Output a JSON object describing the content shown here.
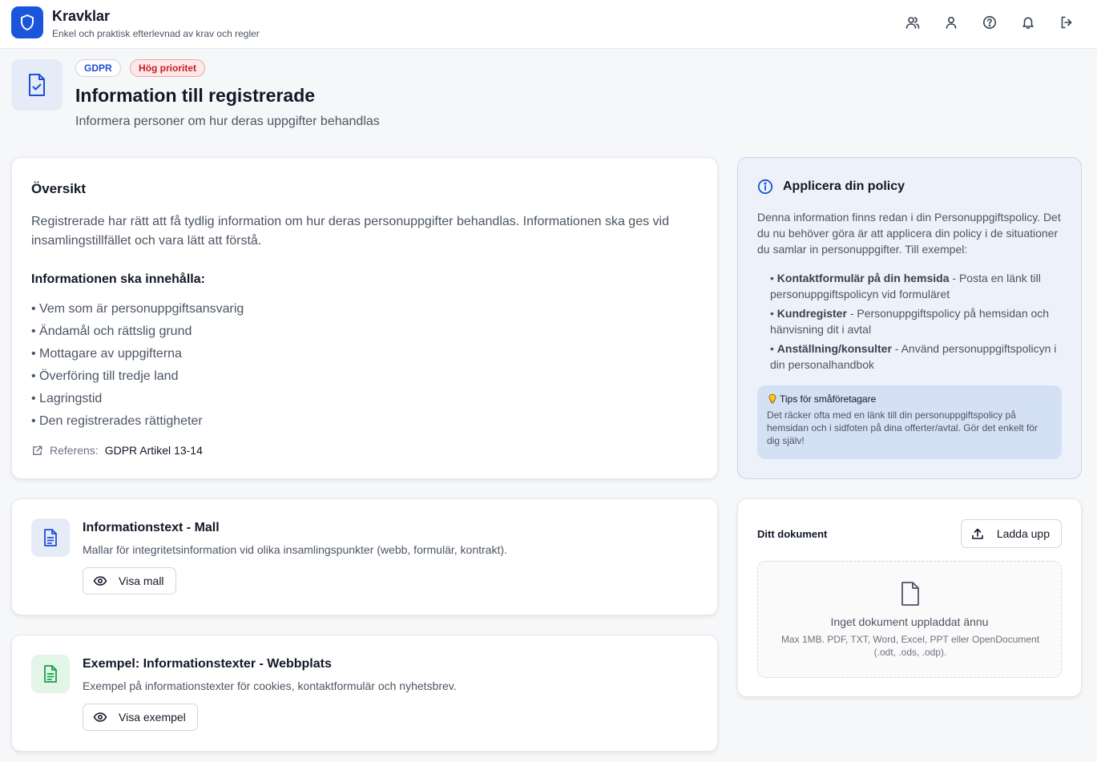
{
  "header": {
    "app_title": "Kravklar",
    "app_subtitle": "Enkel och praktisk efterlevnad av krav och regler",
    "icons": [
      "users-icon",
      "user-icon",
      "help-icon",
      "bell-icon",
      "logout-icon"
    ]
  },
  "page": {
    "badges": {
      "framework": "GDPR",
      "priority": "Hög prioritet"
    },
    "title": "Information till registrerade",
    "subtitle": "Informera personer om hur deras uppgifter behandlas"
  },
  "overview": {
    "title": "Översikt",
    "description": "Registrerade har rätt att få tydlig information om hur deras personuppgifter behandlas. Informationen ska ges vid insamlingstillfället och vara lätt att förstå.",
    "subheading": "Informationen ska innehålla:",
    "items": [
      "• Vem som är personuppgiftsansvarig",
      "• Ändamål och rättslig grund",
      "• Mottagare av uppgifterna",
      "• Överföring till tredje land",
      "• Lagringstid",
      "• Den registrerades rättigheter"
    ],
    "reference_label": "Referens:",
    "reference_value": "GDPR Artikel 13-14"
  },
  "resources": [
    {
      "title": "Informationstext - Mall",
      "description": "Mallar för integritetsinformation vid olika insamlingspunkter (webb, formulär, kontrakt).",
      "button": "Visa mall",
      "accent": "#1d4ed8"
    },
    {
      "title": "Exempel: Informationstexter - Webbplats",
      "description": "Exempel på informationstexter för cookies, kontaktformulär och nyhetsbrev.",
      "button": "Visa exempel",
      "accent": "#16a34a"
    }
  ],
  "policy": {
    "title": "Applicera din policy",
    "description": "Denna information finns redan i din Personuppgiftspolicy. Det du nu behöver göra är att applicera din policy i de situationer du samlar in personuppgifter. Till exempel:",
    "items": [
      {
        "bold": "Kontaktformulär på din hemsida",
        "text": " - Posta en länk till personuppgiftspolicyn vid formuläret"
      },
      {
        "bold": "Kundregister",
        "text": " - Personuppgiftspolicy på hemsidan och hänvisning dit i avtal"
      },
      {
        "bold": "Anställning/konsulter",
        "text": " - Använd personuppgiftspolicyn i din personalhandbok"
      }
    ],
    "tip_title": "Tips för småföretagare",
    "tip_text": "Det räcker ofta med en länk till din personuppgiftspolicy på hemsidan och i sidfoten på dina offerter/avtal. Gör det enkelt för dig själv!"
  },
  "document": {
    "title": "Ditt dokument",
    "upload_button": "Ladda upp",
    "empty_text": "Inget dokument uppladdat ännu",
    "hint": "Max 1MB. PDF, TXT, Word, Excel, PPT eller OpenDocument (.odt, .ods, .odp)."
  },
  "colors": {
    "brand": "#1a56db",
    "priority_bg": "#fde8e8",
    "priority_text": "#c81e1e",
    "policy_bg": "#edf2fa",
    "tip_bg": "#d4e0f3"
  }
}
